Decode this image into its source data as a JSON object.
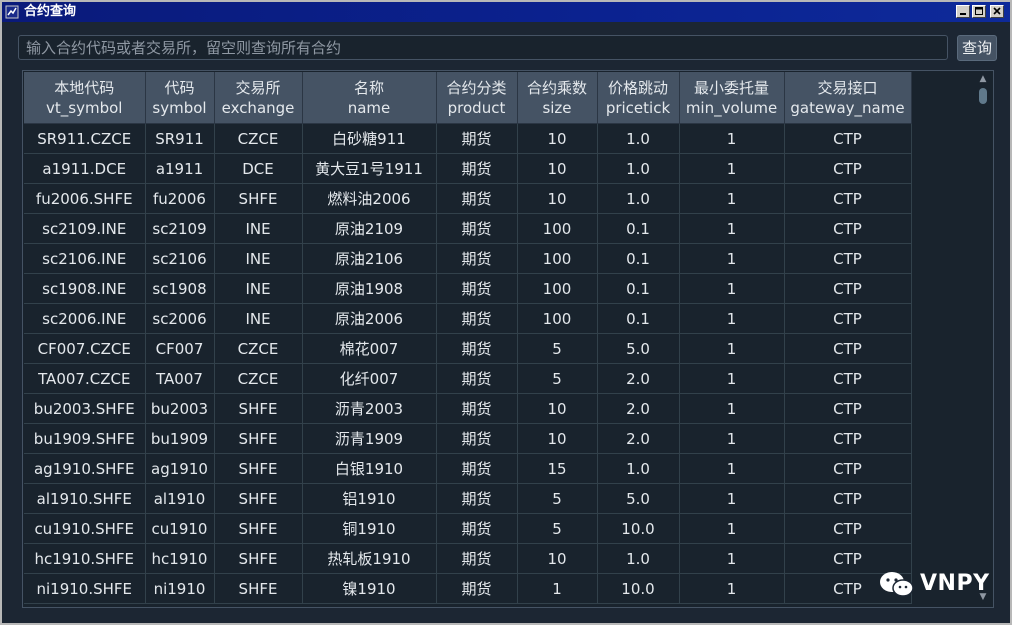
{
  "window": {
    "title": "合约查询"
  },
  "search": {
    "placeholder": "输入合约代码或者交易所，留空则查询所有合约",
    "value": "",
    "button_label": "查询"
  },
  "table": {
    "columns": [
      {
        "cn": "本地代码",
        "en": "vt_symbol"
      },
      {
        "cn": "代码",
        "en": "symbol"
      },
      {
        "cn": "交易所",
        "en": "exchange"
      },
      {
        "cn": "名称",
        "en": "name"
      },
      {
        "cn": "合约分类",
        "en": "product"
      },
      {
        "cn": "合约乘数",
        "en": "size"
      },
      {
        "cn": "价格跳动",
        "en": "pricetick"
      },
      {
        "cn": "最小委托量",
        "en": "min_volume"
      },
      {
        "cn": "交易接口",
        "en": "gateway_name"
      }
    ],
    "rows": [
      [
        "SR911.CZCE",
        "SR911",
        "CZCE",
        "白砂糖911",
        "期货",
        "10",
        "1.0",
        "1",
        "CTP"
      ],
      [
        "a1911.DCE",
        "a1911",
        "DCE",
        "黄大豆1号1911",
        "期货",
        "10",
        "1.0",
        "1",
        "CTP"
      ],
      [
        "fu2006.SHFE",
        "fu2006",
        "SHFE",
        "燃料油2006",
        "期货",
        "10",
        "1.0",
        "1",
        "CTP"
      ],
      [
        "sc2109.INE",
        "sc2109",
        "INE",
        "原油2109",
        "期货",
        "100",
        "0.1",
        "1",
        "CTP"
      ],
      [
        "sc2106.INE",
        "sc2106",
        "INE",
        "原油2106",
        "期货",
        "100",
        "0.1",
        "1",
        "CTP"
      ],
      [
        "sc1908.INE",
        "sc1908",
        "INE",
        "原油1908",
        "期货",
        "100",
        "0.1",
        "1",
        "CTP"
      ],
      [
        "sc2006.INE",
        "sc2006",
        "INE",
        "原油2006",
        "期货",
        "100",
        "0.1",
        "1",
        "CTP"
      ],
      [
        "CF007.CZCE",
        "CF007",
        "CZCE",
        "棉花007",
        "期货",
        "5",
        "5.0",
        "1",
        "CTP"
      ],
      [
        "TA007.CZCE",
        "TA007",
        "CZCE",
        "化纤007",
        "期货",
        "5",
        "2.0",
        "1",
        "CTP"
      ],
      [
        "bu2003.SHFE",
        "bu2003",
        "SHFE",
        "沥青2003",
        "期货",
        "10",
        "2.0",
        "1",
        "CTP"
      ],
      [
        "bu1909.SHFE",
        "bu1909",
        "SHFE",
        "沥青1909",
        "期货",
        "10",
        "2.0",
        "1",
        "CTP"
      ],
      [
        "ag1910.SHFE",
        "ag1910",
        "SHFE",
        "白银1910",
        "期货",
        "15",
        "1.0",
        "1",
        "CTP"
      ],
      [
        "al1910.SHFE",
        "al1910",
        "SHFE",
        "铝1910",
        "期货",
        "5",
        "5.0",
        "1",
        "CTP"
      ],
      [
        "cu1910.SHFE",
        "cu1910",
        "SHFE",
        "铜1910",
        "期货",
        "5",
        "10.0",
        "1",
        "CTP"
      ],
      [
        "hc1910.SHFE",
        "hc1910",
        "SHFE",
        "热轧板1910",
        "期货",
        "10",
        "1.0",
        "1",
        "CTP"
      ],
      [
        "ni1910.SHFE",
        "ni1910",
        "SHFE",
        "镍1910",
        "期货",
        "1",
        "10.0",
        "1",
        "CTP"
      ]
    ]
  },
  "watermark": {
    "text": "VNPY",
    "icon": "wechat-icon"
  },
  "colors": {
    "titlebar": "#0b2290",
    "background": "#1c2633",
    "header": "#455364",
    "grid": "#32414b"
  }
}
